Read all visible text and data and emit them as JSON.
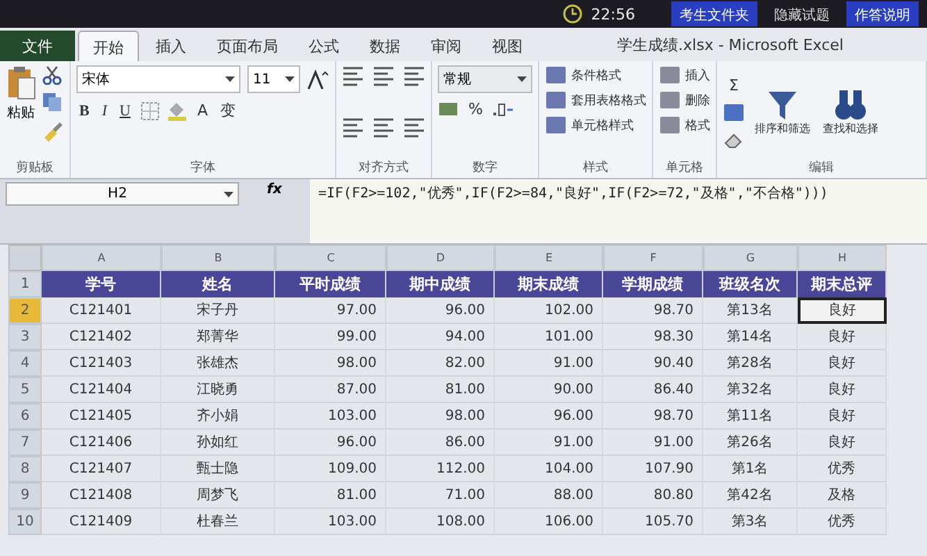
{
  "top_bar": {
    "time": "22:56",
    "buttons": [
      {
        "label": "考生文件夹",
        "highlighted": true
      },
      {
        "label": "隐藏试题",
        "highlighted": false
      },
      {
        "label": "作答说明",
        "highlighted": true
      }
    ]
  },
  "window": {
    "title": "学生成绩.xlsx - Microsoft Excel"
  },
  "tabs": [
    {
      "label": "文件",
      "kind": "file",
      "selected": false
    },
    {
      "label": "开始",
      "kind": "tab",
      "selected": true
    },
    {
      "label": "插入",
      "kind": "tab",
      "selected": false
    },
    {
      "label": "页面布局",
      "kind": "tab",
      "selected": false
    },
    {
      "label": "公式",
      "kind": "tab",
      "selected": false
    },
    {
      "label": "数据",
      "kind": "tab",
      "selected": false
    },
    {
      "label": "审阅",
      "kind": "tab",
      "selected": false
    },
    {
      "label": "视图",
      "kind": "tab",
      "selected": false
    }
  ],
  "ribbon": {
    "clipboard": {
      "paste": "粘贴",
      "label": "剪贴板"
    },
    "font": {
      "name": "宋体",
      "size": "11",
      "bold": "B",
      "italic": "I",
      "underline": "U",
      "font_color": "A",
      "phonetic": "变",
      "label": "字体"
    },
    "alignment": {
      "label": "对齐方式"
    },
    "number": {
      "format": "常规",
      "percent": "%",
      "label": "数字"
    },
    "styles": {
      "items": [
        "条件格式",
        "套用表格格式",
        "单元格样式"
      ],
      "label": "样式"
    },
    "cells": {
      "items": [
        "插入",
        "删除",
        "格式"
      ],
      "label": "单元格"
    },
    "editing": {
      "sum": "Σ",
      "items": [
        "排序和筛选",
        "查找和选择"
      ],
      "label": "编辑"
    }
  },
  "formula_bar": {
    "name_box": "H2",
    "fx": "fx",
    "formula": "=IF(F2>=102,\"优秀\",IF(F2>=84,\"良好\",IF(F2>=72,\"及格\",\"不合格\")))"
  },
  "sheet": {
    "columns": [
      "A",
      "B",
      "C",
      "D",
      "E",
      "F",
      "G",
      "H"
    ],
    "header_row": {
      "number": "1",
      "cells": [
        "学号",
        "姓名",
        "平时成绩",
        "期中成绩",
        "期末成绩",
        "学期成绩",
        "班级名次",
        "期末总评"
      ]
    },
    "rows": [
      {
        "number": "2",
        "selected": true,
        "cells": [
          "C121401",
          "宋子丹",
          "97.00",
          "96.00",
          "102.00",
          "98.70",
          "第13名",
          "良好"
        ]
      },
      {
        "number": "3",
        "selected": false,
        "cells": [
          "C121402",
          "郑菁华",
          "99.00",
          "94.00",
          "101.00",
          "98.30",
          "第14名",
          "良好"
        ]
      },
      {
        "number": "4",
        "selected": false,
        "cells": [
          "C121403",
          "张雄杰",
          "98.00",
          "82.00",
          "91.00",
          "90.40",
          "第28名",
          "良好"
        ]
      },
      {
        "number": "5",
        "selected": false,
        "cells": [
          "C121404",
          "江晓勇",
          "87.00",
          "81.00",
          "90.00",
          "86.40",
          "第32名",
          "良好"
        ]
      },
      {
        "number": "6",
        "selected": false,
        "cells": [
          "C121405",
          "齐小娟",
          "103.00",
          "98.00",
          "96.00",
          "98.70",
          "第11名",
          "良好"
        ]
      },
      {
        "number": "7",
        "selected": false,
        "cells": [
          "C121406",
          "孙如红",
          "96.00",
          "86.00",
          "91.00",
          "91.00",
          "第26名",
          "良好"
        ]
      },
      {
        "number": "8",
        "selected": false,
        "cells": [
          "C121407",
          "甄士隐",
          "109.00",
          "112.00",
          "104.00",
          "107.90",
          "第1名",
          "优秀"
        ]
      },
      {
        "number": "9",
        "selected": false,
        "cells": [
          "C121408",
          "周梦飞",
          "81.00",
          "71.00",
          "88.00",
          "80.80",
          "第42名",
          "及格"
        ]
      },
      {
        "number": "10",
        "selected": false,
        "cells": [
          "C121409",
          "杜春兰",
          "103.00",
          "108.00",
          "106.00",
          "105.70",
          "第3名",
          "优秀"
        ]
      }
    ]
  }
}
